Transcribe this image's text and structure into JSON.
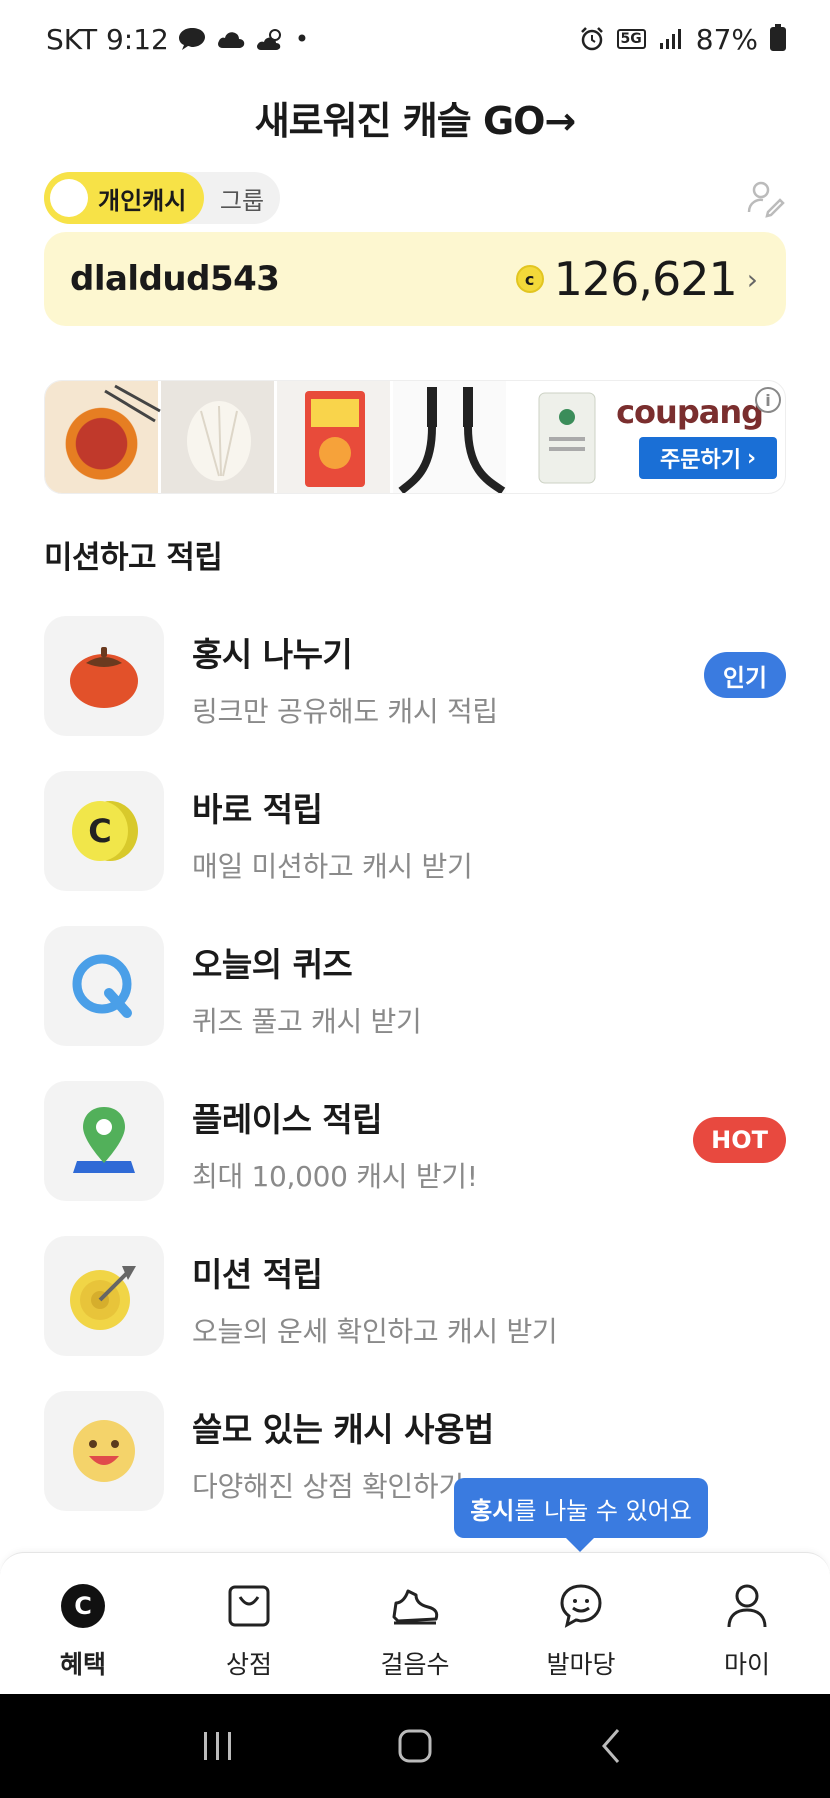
{
  "status_bar": {
    "carrier_time": "SKT 9:12",
    "network": "5G",
    "battery": "87%"
  },
  "header": {
    "title": "새로워진 캐슬   GO→"
  },
  "toggle": {
    "active": "개인캐시",
    "inactive": "그룹"
  },
  "balance": {
    "username": "dlaldud543",
    "coin_symbol": "c",
    "amount": "126,621",
    "chevron": "›"
  },
  "ad": {
    "logo": "coupang",
    "order_button": "주문하기",
    "order_chevron": "›",
    "info": "i"
  },
  "section_title": "미션하고 적립",
  "missions": [
    {
      "title": "홍시 나누기",
      "desc": "링크만 공유해도 캐시 적립",
      "badge": "인기",
      "icon": "persimmon-icon"
    },
    {
      "title": "바로 적립",
      "desc": "매일 미션하고 캐시 받기",
      "badge": "",
      "icon": "coin-icon"
    },
    {
      "title": "오늘의 퀴즈",
      "desc": "퀴즈 풀고 캐시 받기",
      "badge": "",
      "icon": "quiz-q-icon"
    },
    {
      "title": "플레이스 적립",
      "desc": "최대 10,000 캐시 받기!",
      "badge": "HOT",
      "icon": "map-pin-icon"
    },
    {
      "title": "미션 적립",
      "desc": "오늘의 운세 확인하고 캐시 받기",
      "badge": "",
      "icon": "target-icon"
    },
    {
      "title": "쓸모 있는 캐시 사용법",
      "desc": "다양해진 상점 확인하기",
      "badge": "",
      "icon": "smiley-icon"
    }
  ],
  "tooltip": {
    "bold": "홍시",
    "rest": "를 나눌 수 있어요"
  },
  "bottom_nav": [
    {
      "label": "혜택",
      "icon": "cash-c-icon"
    },
    {
      "label": "상점",
      "icon": "shopping-bag-icon"
    },
    {
      "label": "걸음수",
      "icon": "sneaker-icon"
    },
    {
      "label": "발마당",
      "icon": "chat-smile-icon"
    },
    {
      "label": "마이",
      "icon": "person-icon"
    }
  ],
  "colors": {
    "accent_yellow": "#f7e247",
    "balance_bg": "#fdf7d0",
    "badge_blue": "#3a7be0",
    "badge_red": "#e8493f",
    "coupang_button": "#1a6fd6"
  }
}
